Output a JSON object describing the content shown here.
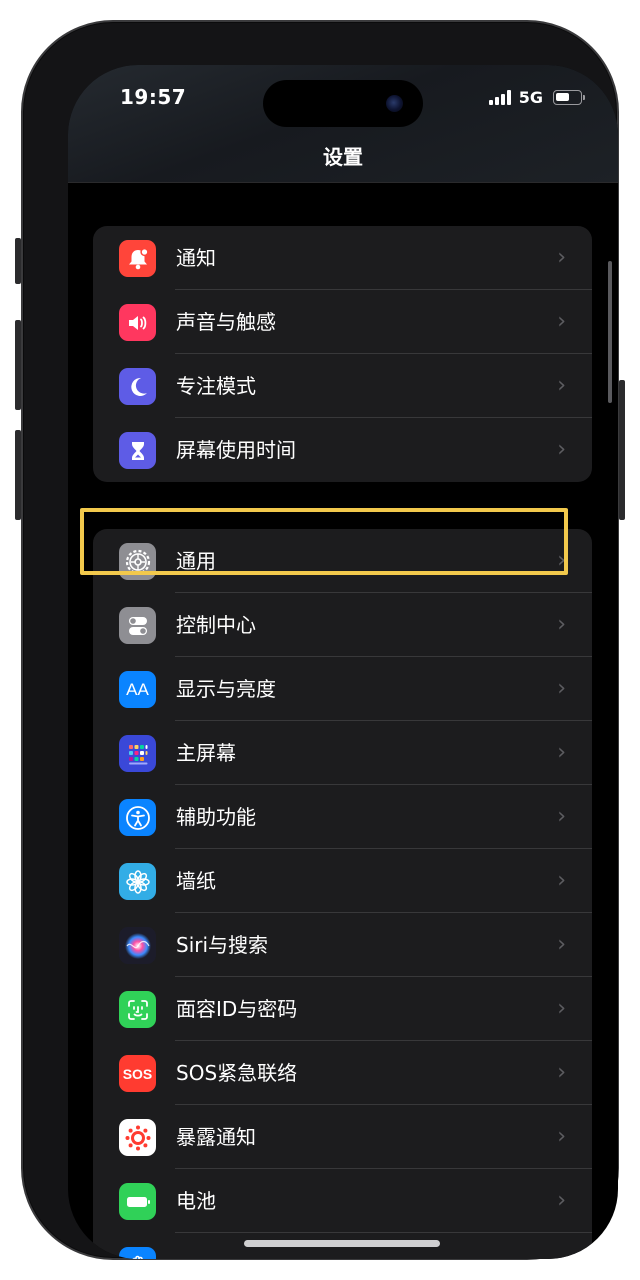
{
  "status_bar": {
    "time": "19:57",
    "network": "5G",
    "battery_level": 0.6
  },
  "nav": {
    "title": "设置"
  },
  "groups": [
    {
      "items": [
        {
          "label": "通知",
          "icon": "bell-icon",
          "color": "#ff453a"
        },
        {
          "label": "声音与触感",
          "icon": "speaker-icon",
          "color": "#ff375f"
        },
        {
          "label": "专注模式",
          "icon": "moon-icon",
          "color": "#5e5ce6"
        },
        {
          "label": "屏幕使用时间",
          "icon": "hourglass-icon",
          "color": "#5e5ce6"
        }
      ]
    },
    {
      "items": [
        {
          "label": "通用",
          "icon": "gear-icon",
          "color": "#8e8e93"
        },
        {
          "label": "控制中心",
          "icon": "toggles-icon",
          "color": "#8e8e93"
        },
        {
          "label": "显示与亮度",
          "icon": "text-size-icon",
          "text": "AA",
          "color": "#0a84ff"
        },
        {
          "label": "主屏幕",
          "icon": "home-grid-icon",
          "color": "#3a48d8"
        },
        {
          "label": "辅助功能",
          "icon": "accessibility-icon",
          "color": "#0a84ff"
        },
        {
          "label": "墙纸",
          "icon": "flower-icon",
          "color": "#32ade6"
        },
        {
          "label": "Siri与搜索",
          "icon": "siri-icon",
          "color": "#1c1c2a"
        },
        {
          "label": "面容ID与密码",
          "icon": "face-id-icon",
          "color": "#30d158"
        },
        {
          "label": "SOS紧急联络",
          "icon": "sos-icon",
          "text": "SOS",
          "color": "#ff3b30"
        },
        {
          "label": "暴露通知",
          "icon": "exposure-icon",
          "color": "#ffffff"
        },
        {
          "label": "电池",
          "icon": "battery-icon",
          "color": "#30d158"
        },
        {
          "label": "",
          "icon": "hand-icon",
          "color": "#0a84ff"
        }
      ]
    }
  ],
  "chevron": "›"
}
